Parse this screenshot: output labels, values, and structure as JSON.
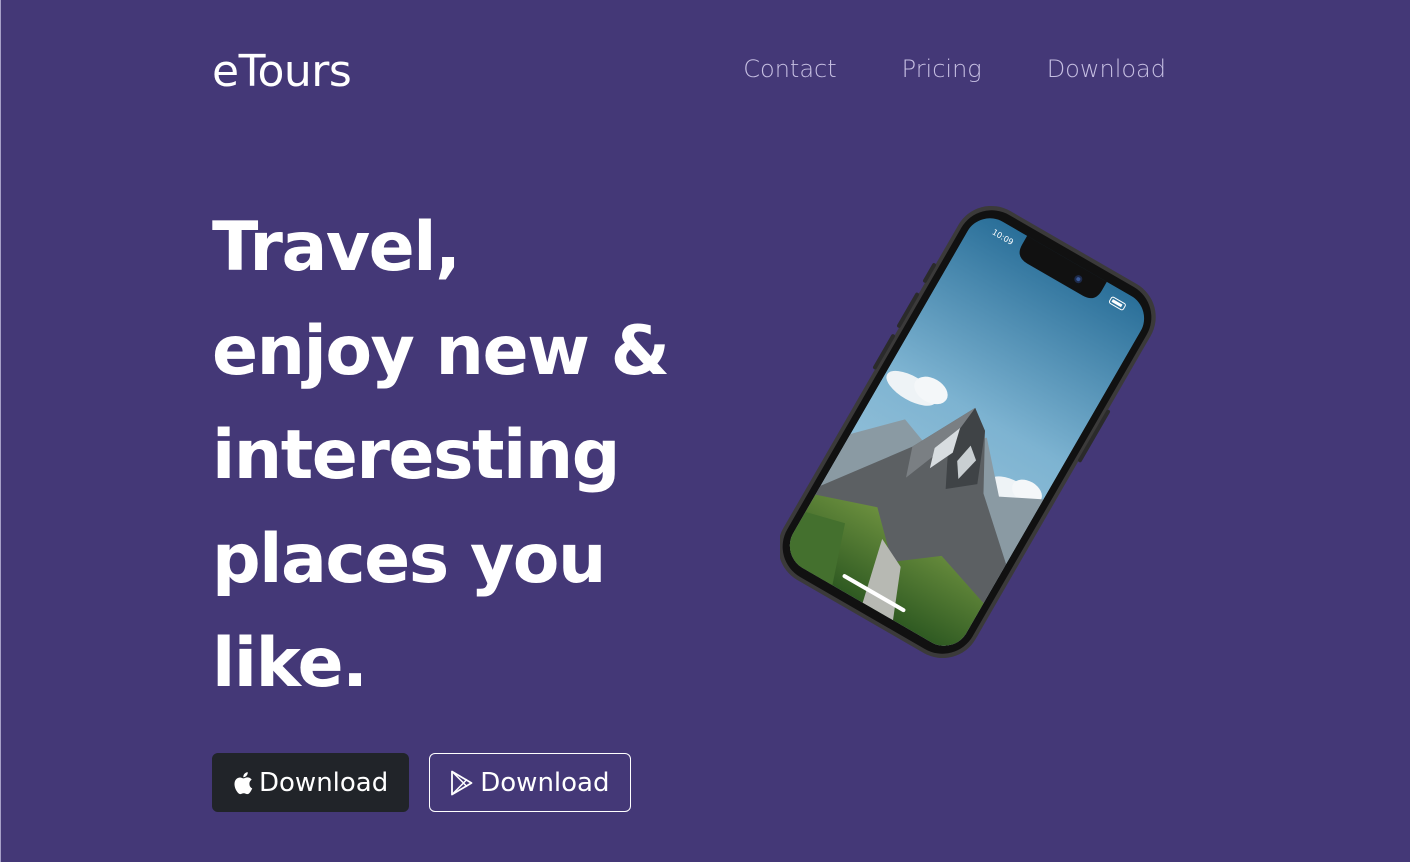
{
  "brand": {
    "name": "eTours"
  },
  "nav": {
    "links": [
      {
        "label": "Contact"
      },
      {
        "label": "Pricing"
      },
      {
        "label": "Download"
      }
    ]
  },
  "hero": {
    "title_lines": [
      "Travel,",
      "enjoy new &",
      "interesting",
      "places you",
      "like."
    ]
  },
  "buttons": {
    "app_store": {
      "label": "Download",
      "icon": "apple-icon"
    },
    "play_store": {
      "label": "Download",
      "icon": "play-store-icon"
    }
  },
  "phone": {
    "status_time": "10:09",
    "screen": "mountain-landscape"
  },
  "colors": {
    "background": "#443877",
    "nav_link": "#c6bfe2",
    "dark_button": "#212429",
    "text": "#ffffff"
  }
}
